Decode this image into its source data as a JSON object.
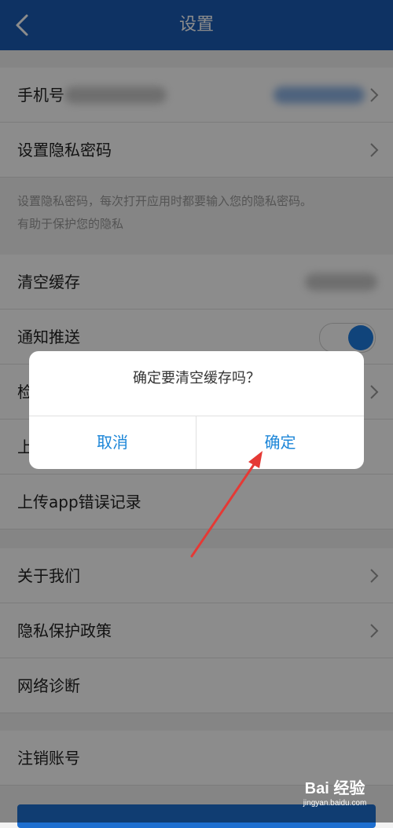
{
  "header": {
    "title": "设置"
  },
  "rows": {
    "phone": {
      "label": "手机号"
    },
    "privacy_password": {
      "label": "设置隐私密码"
    },
    "clear_cache": {
      "label": "清空缓存"
    },
    "notification": {
      "label": "通知推送",
      "enabled": true
    },
    "check_update": {
      "label": "检"
    },
    "upload": {
      "label": "上"
    },
    "upload_error_log": {
      "label": "上传app错误记录"
    },
    "about_us": {
      "label": "关于我们"
    },
    "privacy_policy": {
      "label": "隐私保护政策"
    },
    "network_diagnosis": {
      "label": "网络诊断"
    },
    "delete_account": {
      "label": "注销账号"
    }
  },
  "hint": {
    "line1": "设置隐私密码，每次打开应用时都要输入您的隐私密码。",
    "line2": "有助于保护您的隐私"
  },
  "dialog": {
    "message": "确定要清空缓存吗？",
    "cancel_label": "取消",
    "confirm_label": "确定"
  },
  "annotation": {
    "type": "red-arrow",
    "color": "#e53935",
    "points_to": "confirm-button"
  },
  "watermark": {
    "logo": "Bai 经验",
    "url": "jingyan.baidu.com"
  },
  "colors": {
    "header": "#1a5bb5",
    "accent": "#1c86d8",
    "toggle_on": "#1e7ce0"
  },
  "icons": {
    "back": "chevron-left-icon",
    "row_arrow": "chevron-right-icon"
  }
}
